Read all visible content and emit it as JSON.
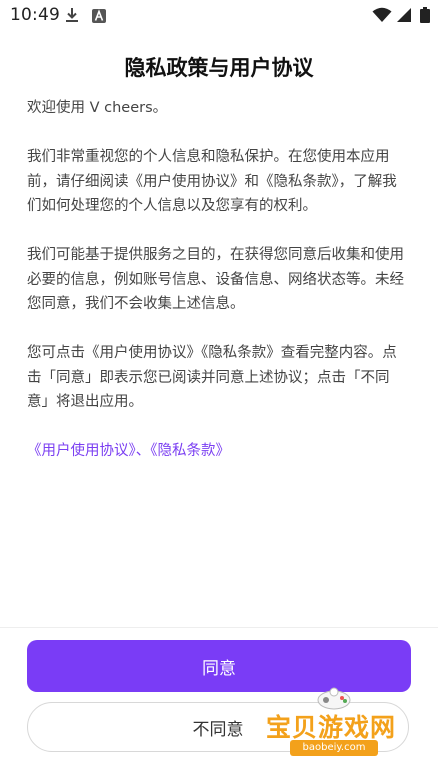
{
  "status_bar": {
    "time": "10:49"
  },
  "title": "隐私政策与用户协议",
  "paragraphs": [
    "欢迎使用 V cheers。",
    "我们非常重视您的个人信息和隐私保护。在您使用本应用前，请仔细阅读《用户使用协议》和《隐私条款》，了解我们如何处理您的个人信息以及您享有的权利。",
    "我们可能基于提供服务之目的，在获得您同意后收集和使用必要的信息，例如账号信息、设备信息、网络状态等。未经您同意，我们不会收集上述信息。",
    "您可点击《用户使用协议》《隐私条款》查看完整内容。点击「同意」即表示您已阅读并同意上述协议；点击「不同意」将退出应用。"
  ],
  "links": {
    "user_agreement": "《用户使用协议》",
    "separator": "、",
    "privacy_terms": "《隐私条款》"
  },
  "buttons": {
    "agree": "同意",
    "disagree": "不同意"
  },
  "watermark": {
    "brand": "宝贝游戏网",
    "url": "baobeiy.com"
  },
  "colors": {
    "accent": "#7a3cf6",
    "link": "#7b3ff2",
    "watermark": "#f3a11b"
  },
  "icons": [
    "download-icon",
    "font-a-icon",
    "wifi-icon",
    "signal-icon",
    "battery-icon"
  ]
}
